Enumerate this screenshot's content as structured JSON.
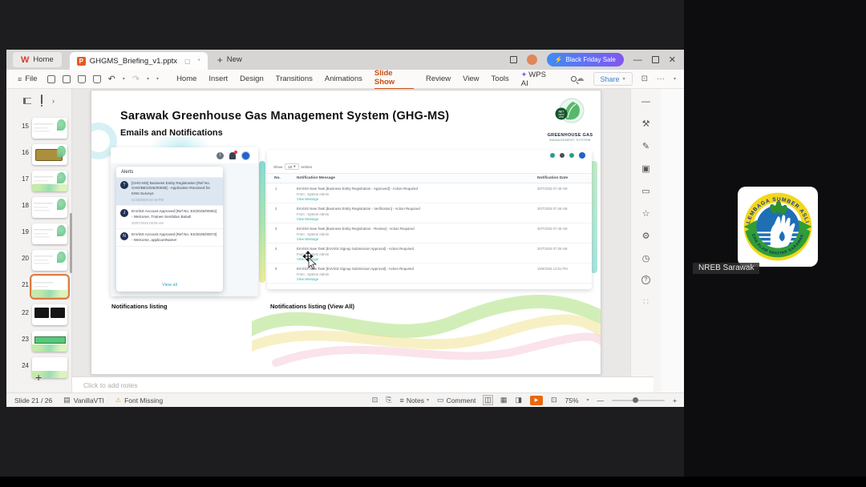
{
  "window": {
    "home_tab": "Home",
    "doc_tab": "GHGMS_Briefing_v1.pptx",
    "doc_modified": "*",
    "new_tab": "New",
    "promo_button": "Black Friday Sale",
    "file_menu": "File",
    "menus": [
      "Home",
      "Insert",
      "Design",
      "Transitions",
      "Animations",
      "Slide Show",
      "Review",
      "View",
      "Tools",
      "WPS AI"
    ],
    "share_button": "Share"
  },
  "thumbnails": {
    "numbers": [
      "15",
      "16",
      "17",
      "18",
      "19",
      "20",
      "21",
      "22",
      "23",
      "24"
    ],
    "add_label": "+"
  },
  "slide": {
    "title": "Sarawak Greenhouse Gas Management System (GHG-MS)",
    "subtitle": "Emails and Notifications",
    "logo": {
      "badge": "NET ZERO 2050",
      "line1": "GREENHOUSE GAS",
      "line2": "MANAGEMENT SYSTEM"
    },
    "alerts": {
      "header": "Alerts",
      "items": [
        {
          "initial": "T",
          "text": "[GHG-MS] Business Entity Registration [Ref No. GHG/BE/2025/00038] - Application Received for KNN Surveys",
          "date": "21/10/2025 02:19 PM"
        },
        {
          "initial": "J",
          "text": "EnViSS Account Approved [Ref No. ES/2025/00081] - Welcome, Trainee Sembilan Balad!",
          "date": "30/07/2025 09:09 AM"
        },
        {
          "initial": "N",
          "text": "EnViSS Account Approved [Ref No. ES/2025/00072] - Welcome, applicantName!",
          "date": ""
        }
      ],
      "view_all": "View all"
    },
    "listing": {
      "show": "Show",
      "show_value": "10",
      "entries": "entries",
      "col_no": "No.",
      "col_message": "Notification Message",
      "col_date": "Notification Date",
      "rows": [
        {
          "no": "1",
          "message": "EnViSS New Task [Business Entity Registration - Approved] - Action Required",
          "from": "From : System Admin",
          "link": "View Message",
          "date": "30/7/2025 07:49 AM"
        },
        {
          "no": "2",
          "message": "EnViSS New Task [Business Entity Registration - Verification] - Action Required",
          "from": "From : System Admin",
          "link": "View Message",
          "date": "30/7/2025 07:49 AM"
        },
        {
          "no": "3",
          "message": "EnViSS New Task [Business Entity Registration - Review] - Action Required",
          "from": "From : System Admin",
          "link": "View Message",
          "date": "30/7/2025 07:46 AM"
        },
        {
          "no": "4",
          "message": "EnViSS New Task [EnViSS Signup Submission Approval] - Action Required",
          "from": "From : System Admin",
          "link": "View Message",
          "date": "30/7/2025 07:39 AM"
        },
        {
          "no": "5",
          "message": "EnViSS New Task [EnViSS Signup Submission Approval] - Action Required",
          "from": "From : System Admin",
          "link": "View Message",
          "date": "18/6/2025 12:51 PM"
        }
      ]
    },
    "caption_left": "Notifications listing",
    "caption_right": "Notifications listing (View All)"
  },
  "notes_placeholder": "Click to add notes",
  "statusbar": {
    "slide_info": "Slide 21 / 26",
    "theme": "VanillaVTI",
    "font_missing": "Font Missing",
    "notes_label": "Notes",
    "comment_label": "Comment",
    "zoom": "75%"
  },
  "participant": {
    "name": "NREB Sarawak",
    "logo_top": "LEMBAGA SUMBER ASLI",
    "logo_bottom": "DAN ALAM SEKITAR SARAWAK"
  },
  "colors": {
    "accent_orange": "#c94f10",
    "promo_from": "#3f8cf5",
    "promo_to": "#8256f0",
    "teal_link": "#2ab3a6",
    "share_blue": "#3d7fd6"
  }
}
